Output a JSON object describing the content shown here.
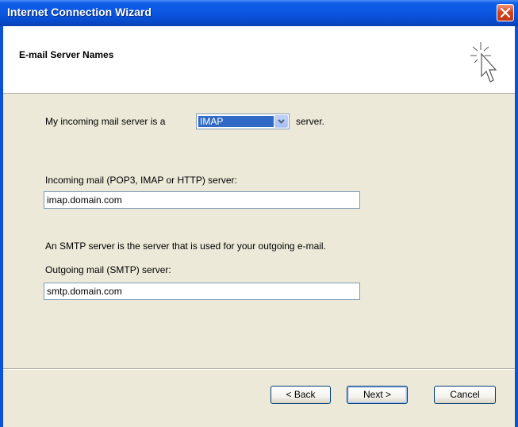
{
  "window": {
    "title": "Internet Connection Wizard"
  },
  "header": {
    "title": "E-mail Server Names",
    "icon": "wizard-pointer-icon"
  },
  "incoming": {
    "prefix": "My incoming mail server is a",
    "server_type": "IMAP",
    "suffix": "server.",
    "label": "Incoming mail (POP3, IMAP or HTTP) server:",
    "value": "imap.domain.com"
  },
  "outgoing": {
    "description": "An SMTP server is the server that is used for your outgoing e-mail.",
    "label": "Outgoing mail (SMTP) server:",
    "value": "smtp.domain.com"
  },
  "buttons": {
    "back": "< Back",
    "next": "Next >",
    "cancel": "Cancel"
  },
  "colors": {
    "title_bar": "#0a55df",
    "dialog_bg": "#ece9d8",
    "selection": "#316ac5",
    "close": "#d5451d"
  }
}
